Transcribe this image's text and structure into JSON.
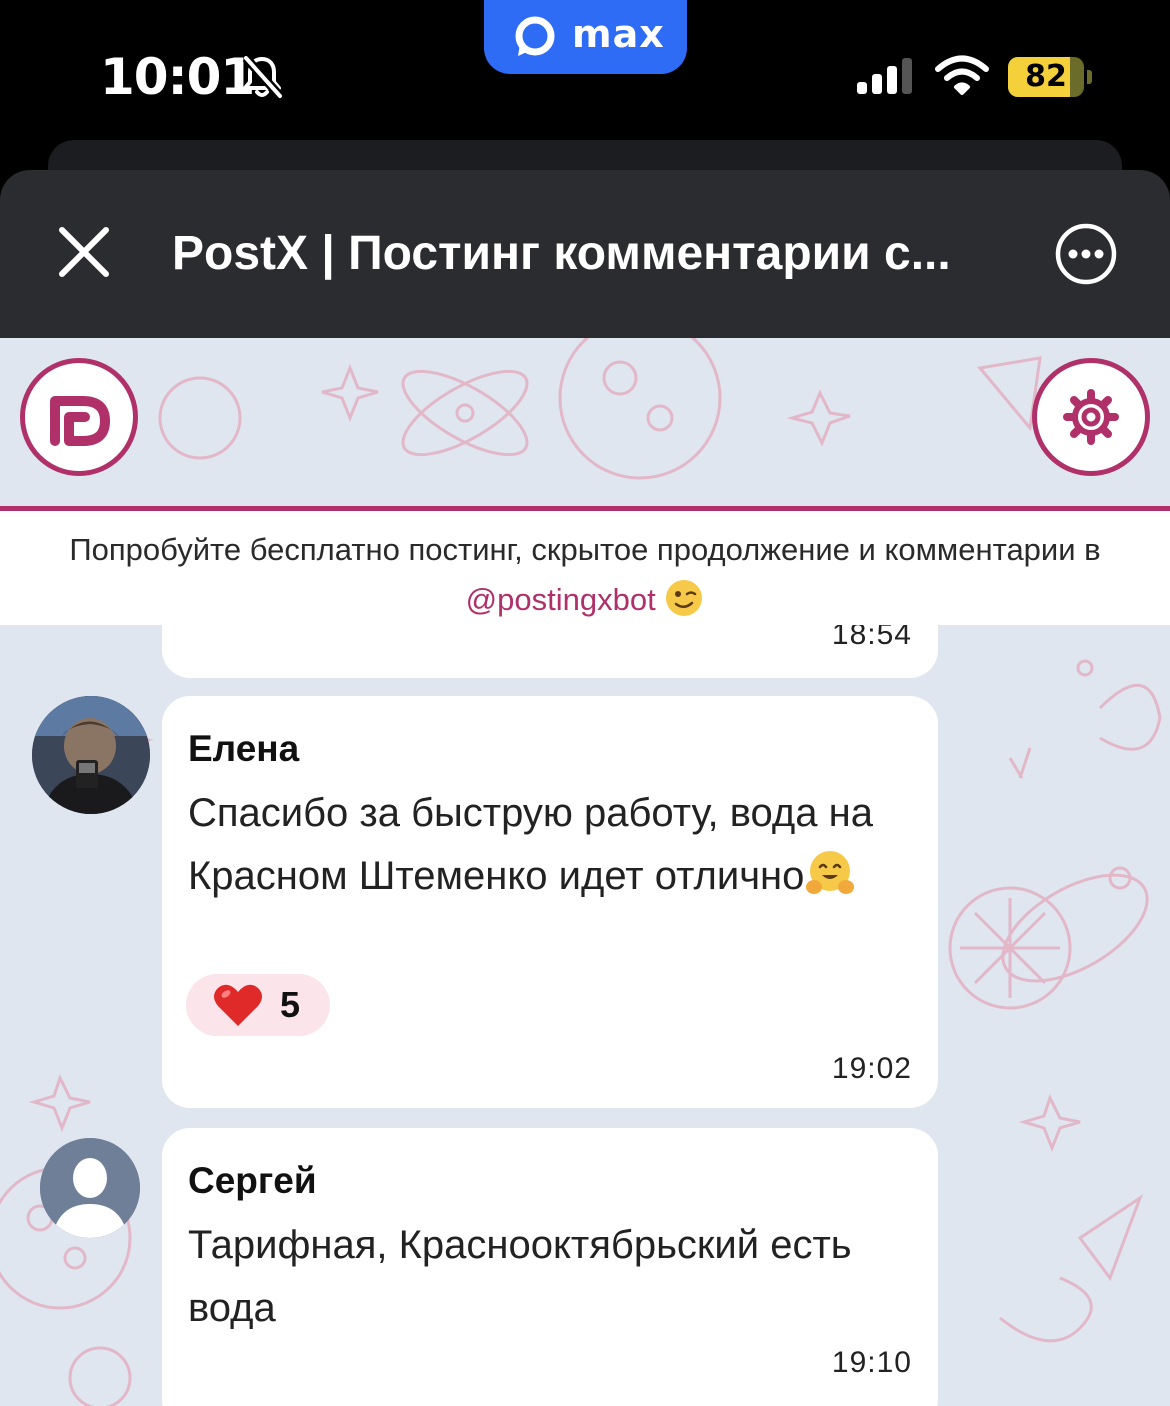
{
  "status_bar": {
    "time": "10:01",
    "app_badge": "max",
    "battery_level": "82",
    "battery_percent": 82
  },
  "header": {
    "title": "PostX | Постинг комментарии с..."
  },
  "promo": {
    "text": "Попробуйте бесплатно постинг, скрытое продолжение и комментарии в ",
    "link": "@postingxbot"
  },
  "messages": [
    {
      "time": "18:54"
    },
    {
      "author": "Елена",
      "text": "Спасибо за быструю работу, вода на Красном Штеменко идет отлично",
      "reaction_count": "5",
      "time": "19:02"
    },
    {
      "author": "Сергей",
      "text": "Тарифная, Краснооктябрьский есть вода",
      "time": "19:10"
    }
  ],
  "colors": {
    "accent": "#b0316a",
    "chat_background": "#dfe6ef",
    "header_background": "#2b2c30",
    "max_badge": "#2e6cf6"
  },
  "icons": {
    "mute": "bell-slash-icon",
    "close": "close-icon",
    "more": "more-icon",
    "settings": "gear-icon",
    "reaction": "heart-icon"
  }
}
